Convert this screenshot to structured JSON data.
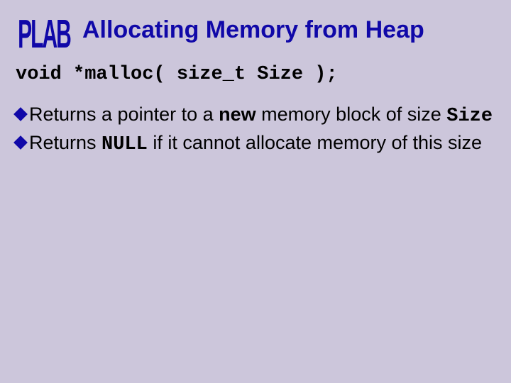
{
  "logo_text": "PLAB",
  "title": "Allocating Memory from Heap",
  "prototype": "void *malloc( size_t Size );",
  "bullets": [
    {
      "a": "Returns a pointer to a ",
      "b": "new",
      "c": " memory block of size ",
      "d": "Size"
    },
    {
      "a": "Returns ",
      "b": "NULL",
      "c": " if it cannot allocate memory of this size"
    }
  ]
}
